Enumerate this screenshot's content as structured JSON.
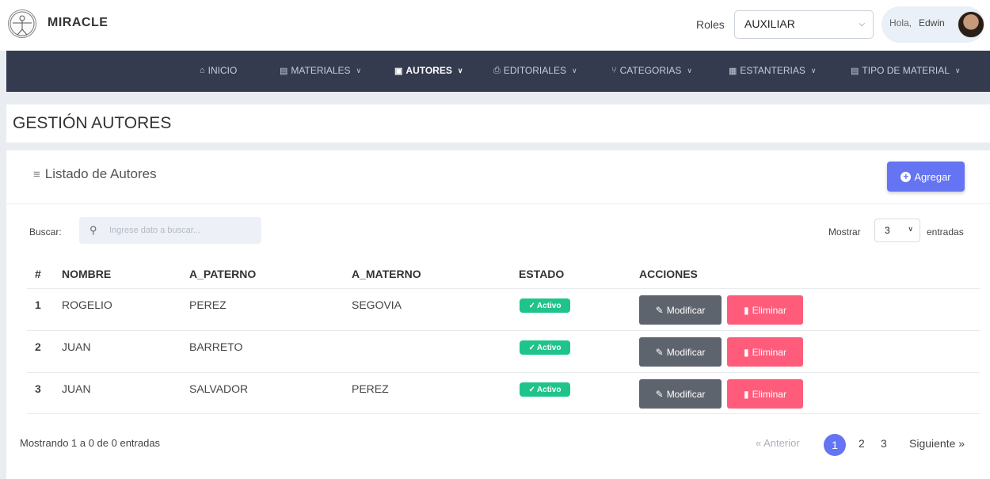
{
  "app": {
    "brand": "MIRACLE"
  },
  "header": {
    "roles_label": "Roles",
    "roles_value": "AUXILIAR",
    "greeting": "Hola,",
    "user_name": "Edwin"
  },
  "nav": {
    "items": [
      {
        "label": "INICIO",
        "icon": "home-icon"
      },
      {
        "label": "MATERIALES",
        "icon": "book-icon"
      },
      {
        "label": "AUTORES",
        "icon": "user-box-icon",
        "active": true
      },
      {
        "label": "EDITORIALES",
        "icon": "printer-icon"
      },
      {
        "label": "CATEGORIAS",
        "icon": "tree-icon"
      },
      {
        "label": "ESTANTERIAS",
        "icon": "shelf-icon"
      },
      {
        "label": "TIPO DE MATERIAL",
        "icon": "book-icon"
      }
    ]
  },
  "page": {
    "title": "GESTIÓN AUTORES"
  },
  "card": {
    "title": "Listado de Autores",
    "add_label": "Agregar"
  },
  "search": {
    "label": "Buscar:",
    "placeholder": "Ingrese dato a buscar...",
    "value": ""
  },
  "page_size": {
    "show_label": "Mostrar",
    "value": "3",
    "entries_label": "entradas"
  },
  "table": {
    "headers": [
      "#",
      "NOMBRE",
      "A_PATERNO",
      "A_MATERNO",
      "ESTADO",
      "ACCIONES"
    ],
    "rows": [
      {
        "num": "1",
        "nombre": "ROGELIO",
        "paterno": "PEREZ",
        "materno": "SEGOVIA",
        "estado": "Activo"
      },
      {
        "num": "2",
        "nombre": "JUAN",
        "paterno": "BARRETO",
        "materno": "",
        "estado": "Activo"
      },
      {
        "num": "3",
        "nombre": "JUAN",
        "paterno": "SALVADOR",
        "materno": "PEREZ",
        "estado": "Activo"
      }
    ],
    "modify_label": "Modificar",
    "delete_label": "Eliminar"
  },
  "footer": {
    "info": "Mostrando 1 a 0 de 0 entradas",
    "prev": "« Anterior",
    "pages": [
      "1",
      "2",
      "3"
    ],
    "current_page": "1",
    "next": "Siguiente »"
  },
  "colors": {
    "nav_bg": "#343b4f",
    "primary": "#6474f2",
    "success": "#1ec48a",
    "danger": "#ff5c7c",
    "secondary": "#5e646e"
  }
}
